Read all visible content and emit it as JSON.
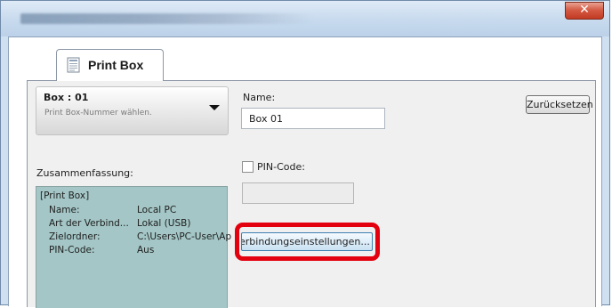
{
  "window": {
    "close_glyph": "✕",
    "close_color": "#c8402a"
  },
  "tab": {
    "label": "Print Box",
    "icon": "print-box-icon"
  },
  "box_selector": {
    "value": "Box : 01",
    "hint": "Print Box-Nummer wählen.",
    "icon": "dropdown-arrow-icon"
  },
  "name_field": {
    "label": "Name:",
    "value": "Box 01"
  },
  "reset_button": {
    "label": "Zurücksetzen"
  },
  "summary": {
    "label": "Zusammenfassung:",
    "heading": "[Print Box]",
    "background": "#a4c6c6",
    "rows": [
      {
        "key": "Name:",
        "value": "Local PC"
      },
      {
        "key": "Art der Verbind...",
        "value": "Lokal (USB)"
      },
      {
        "key": "Zielordner:",
        "value": "C:\\Users\\PC-User\\Ap"
      },
      {
        "key": "PIN-Code:",
        "value": "Aus"
      }
    ]
  },
  "pin": {
    "label": "PIN-Code:",
    "checked": false,
    "value": ""
  },
  "connection_button": {
    "label": "erbindungseinstellungen...",
    "highlight_color": "#e3000f"
  }
}
